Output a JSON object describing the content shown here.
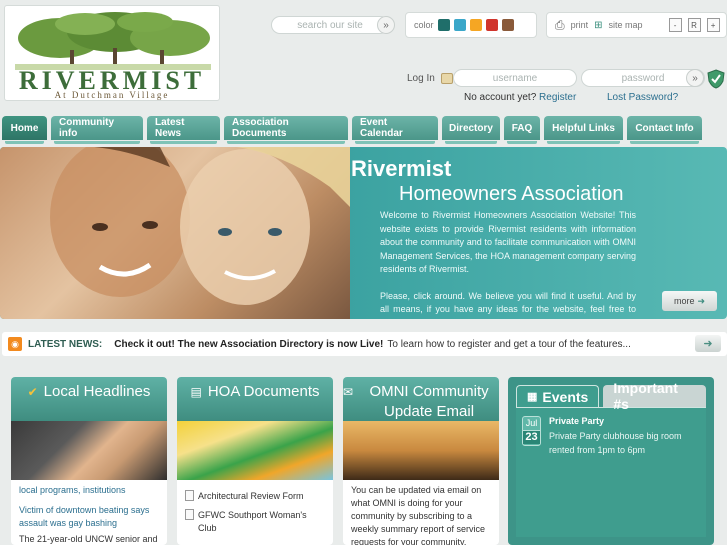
{
  "header": {
    "brand": "RIVERMIST",
    "sub": "At Dutchman Village",
    "search_placeholder": "search our site",
    "color_label": "color",
    "colors": [
      "#1f6e6a",
      "#3aa7c9",
      "#f5a623",
      "#d0342c",
      "#8a5a3a"
    ],
    "print_label": "print",
    "sitemap_label": "site map",
    "font_buttons": [
      "-",
      "R",
      "+"
    ]
  },
  "login": {
    "label": "Log In",
    "username_placeholder": "username",
    "password_placeholder": "password",
    "no_account": "No account yet?",
    "register": "Register",
    "lost_password": "Lost Password?"
  },
  "nav": {
    "items": [
      "Home",
      "Community info",
      "Latest News",
      "Association Documents",
      "Event Calendar",
      "Directory",
      "FAQ",
      "Helpful Links",
      "Contact Info"
    ]
  },
  "banner": {
    "title": "Rivermist",
    "subtitle": "Homeowners Association",
    "para1": "Welcome to Rivermist Homeowners Association Website! This website exists to provide Rivermist residents with information about the community and to facilitate communication with OMNI Management Services, the HOA management company serving residents of Rivermist.",
    "para2": "Please, click around. We believe you will find it useful. And by all means, if you have any ideas for the website, feel free to contact us.",
    "more": "more"
  },
  "ticker": {
    "label": "LATEST NEWS:",
    "bold": "Check it out! The new Association Directory is now Live!",
    "text": "To learn how to register and get a tour of the features..."
  },
  "columns": {
    "local": {
      "title": "Local Headlines",
      "line1": "local programs, institutions",
      "headline": "Victim of downtown beating says assault was gay bashing",
      "body": "The 21-year-old UNCW senior and"
    },
    "hoa": {
      "title": "HOA Documents",
      "docs": [
        "Architectural Review Form",
        "GFWC Southport Woman's Club"
      ]
    },
    "omni": {
      "title": "OMNI Community Update Email",
      "body": "You can be updated via email on what OMNI is doing for your community by subscribing to a weekly summary report of service requests for your community."
    }
  },
  "events": {
    "tab_events": "Events",
    "tab_important": "Important #s",
    "month": "Jul",
    "day": "23",
    "title": "Private Party",
    "desc": "Private Party clubhouse big room rented from 1pm to 6pm"
  }
}
